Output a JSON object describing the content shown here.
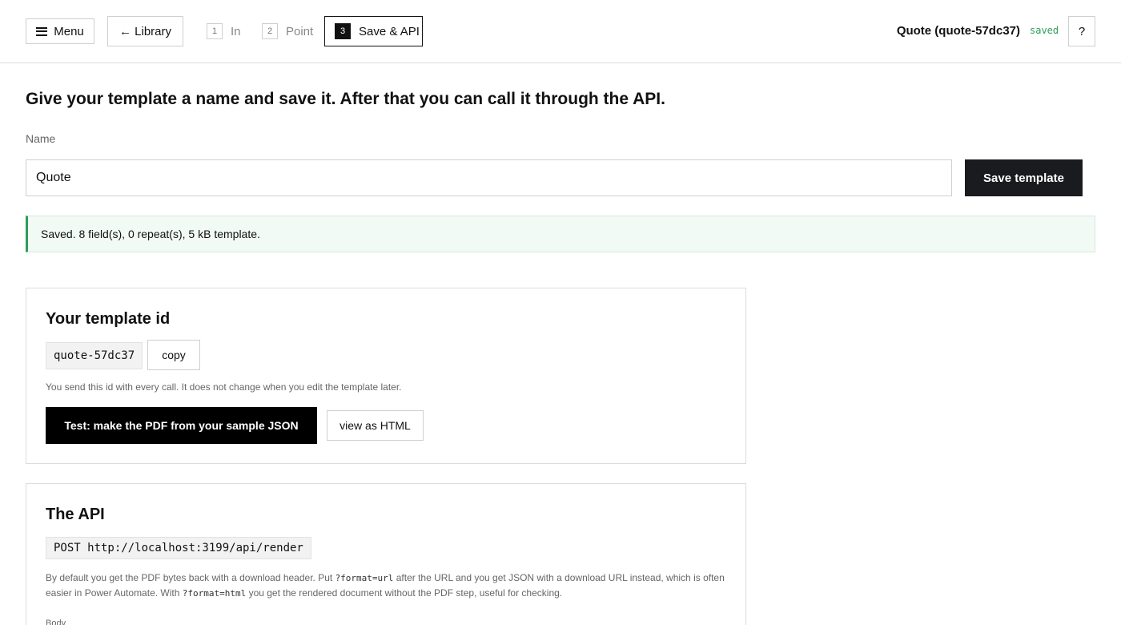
{
  "header": {
    "menu_label": "Menu",
    "library_label": "← Library",
    "steps": [
      {
        "num": "1",
        "label": "In"
      },
      {
        "num": "2",
        "label": "Point"
      },
      {
        "num": "3",
        "label": "Save & API"
      }
    ],
    "doc_title": "Quote (quote-57dc37)",
    "status": "saved",
    "help_label": "?"
  },
  "main": {
    "headline": "Give your template a name and save it. After that you can call it through the API.",
    "name_label": "Name",
    "name_value": "Quote",
    "save_label": "Save template",
    "notice": "Saved. 8 field(s), 0 repeat(s), 5 kB template."
  },
  "template_card": {
    "title": "Your template id",
    "template_id": "quote-57dc37",
    "copy_label": "copy",
    "hint": "You send this id with every call. It does not change when you edit the template later.",
    "test_label": "Test: make the PDF from your sample JSON",
    "html_label": "view as HTML"
  },
  "api_card": {
    "title": "The API",
    "endpoint": "POST http://localhost:3199/api/render",
    "desc_part1": "By default you get the PDF bytes back with a download header. Put ",
    "desc_code1": "?format=url",
    "desc_part2": " after the URL and you get JSON with a download URL instead, which is often easier in Power Automate. With ",
    "desc_code2": "?format=html",
    "desc_part3": " you get the rendered document without the PDF step, useful for checking.",
    "body_label": "Body"
  },
  "colors": {
    "accent_green": "#2e9d59",
    "dark_button": "#1a1b1e",
    "black": "#000000"
  }
}
